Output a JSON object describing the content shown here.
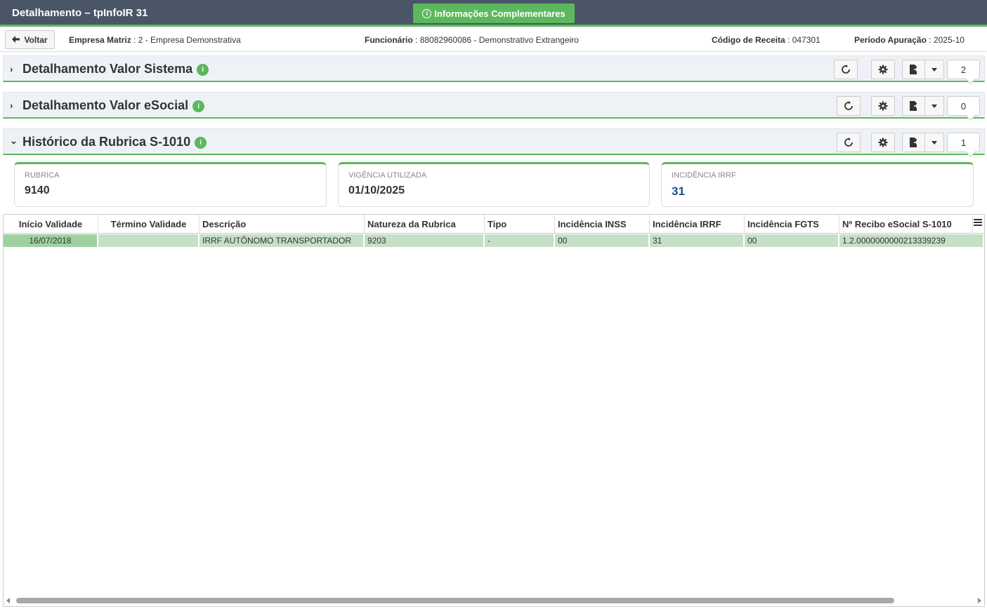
{
  "window": {
    "title": "Detalhamento – tpInfoIR 31"
  },
  "info_button": {
    "label": "Informações Complementares",
    "icon": "info-icon"
  },
  "infobar": {
    "back_label": "Voltar",
    "empresa_label": "Empresa Matriz",
    "empresa_value": "2 - Empresa Demonstrativa",
    "funcionario_label": "Funcionário",
    "funcionario_value": "88082960086 - Demonstrativo Extrangeiro",
    "codigo_label": "Código de Receita",
    "codigo_value": "047301",
    "periodo_label": "Período Apuração",
    "periodo_value": "2025-10"
  },
  "panels": [
    {
      "title": "Detalhamento Valor Sistema",
      "badge": "i",
      "count": "2",
      "expanded": false
    },
    {
      "title": "Detalhamento Valor eSocial",
      "badge": "i",
      "count": "0",
      "expanded": false
    },
    {
      "title": "Histórico da Rubrica S-1010",
      "badge": "i",
      "count": "1",
      "expanded": true
    }
  ],
  "cards": [
    {
      "label": "RUBRICA",
      "value": "9140"
    },
    {
      "label": "VIGÊNCIA UTILIZADA",
      "value": "01/10/2025"
    },
    {
      "label": "INCIDÊNCIA IRRF",
      "value": "31"
    }
  ],
  "table": {
    "columns": [
      "Início Validade",
      "Término Validade",
      "Descrição",
      "Natureza da Rubrica",
      "Tipo",
      "Incidência INSS",
      "Incidência IRRF",
      "Incidência FGTS",
      "Nº Recibo eSocial S-1010"
    ],
    "rows": [
      [
        "16/07/2018",
        "",
        "IRRF AUTÔNOMO TRANSPORTADOR",
        "9203",
        "-",
        "00",
        "31",
        "00",
        "1.2.0000000000213339239"
      ]
    ]
  },
  "colors": {
    "accent": "#5cb85c",
    "titlebar": "#4a5568",
    "row_highlight": "#c6dfc7",
    "value_blue": "#1f4f8c"
  }
}
